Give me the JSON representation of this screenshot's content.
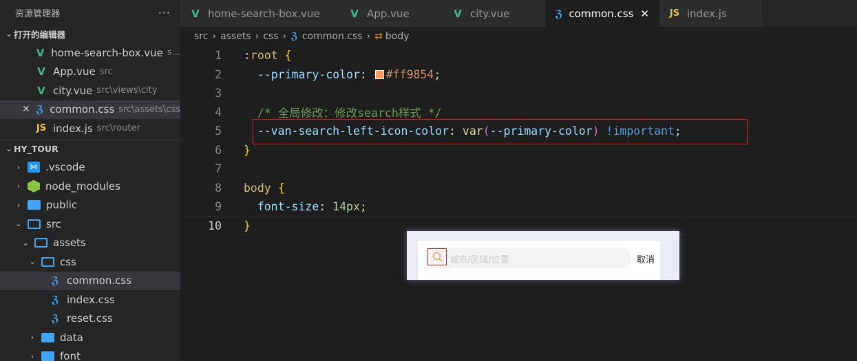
{
  "sidebar": {
    "title": "资源管理器",
    "more": "···",
    "open_editors_title": "打开的编辑器",
    "open_editors": [
      {
        "icon": "vue-icon",
        "name": "home-search-box.vue",
        "path": "s..."
      },
      {
        "icon": "vue-icon",
        "name": "App.vue",
        "path": "src"
      },
      {
        "icon": "vue-icon",
        "name": "city.vue",
        "path": "src\\views\\city"
      },
      {
        "icon": "css-icon",
        "name": "common.css",
        "path": "src\\assets\\css"
      },
      {
        "icon": "js-icon",
        "name": "index.js",
        "path": "src\\router"
      }
    ],
    "project_title": "HY_TOUR",
    "tree": [
      {
        "name": ".vscode"
      },
      {
        "name": "node_modules"
      },
      {
        "name": "public"
      },
      {
        "name": "src"
      },
      {
        "name": "assets"
      },
      {
        "name": "css"
      },
      {
        "name": "common.css"
      },
      {
        "name": "index.css"
      },
      {
        "name": "reset.css"
      },
      {
        "name": "data"
      },
      {
        "name": "font"
      }
    ]
  },
  "tabs": [
    {
      "label": "home-search-box.vue",
      "icon": "vue-icon"
    },
    {
      "label": "App.vue",
      "icon": "vue-icon"
    },
    {
      "label": "city.vue",
      "icon": "vue-icon"
    },
    {
      "label": "common.css",
      "icon": "css-icon",
      "active": true
    },
    {
      "label": "index.js",
      "icon": "js-icon"
    }
  ],
  "breadcrumb": [
    "src",
    "assets",
    "css",
    "common.css",
    "body"
  ],
  "editor": {
    "line_numbers": [
      "1",
      "2",
      "3",
      "4",
      "5",
      "6",
      "7",
      "8",
      "9",
      "10"
    ],
    "l1_sel": ":root",
    "l1_brace": "{",
    "l2_prop": "--primary-color",
    "l2_colon": ":",
    "l2_val": "#ff9854",
    "l2_semi": ";",
    "l4_comment": "/* 全局修改：修改search样式 */",
    "l5_prop": "--van-search-left-icon-color",
    "l5_colon": ":",
    "l5_fn": "var",
    "l5_open": "(",
    "l5_arg": "--primary-color",
    "l5_close": ")",
    "l5_imp": "!important",
    "l5_semi": ";",
    "l6_brace": "}",
    "l8_sel": "body",
    "l8_brace": "{",
    "l9_prop": "font-size",
    "l9_colon": ":",
    "l9_val": "14px",
    "l9_semi": ";",
    "l10_brace": "}"
  },
  "preview": {
    "placeholder": "城市/区域/位置",
    "cancel": "取消"
  },
  "colors": {
    "accent": "#ff9854",
    "highlight_border": "#d9262c"
  }
}
